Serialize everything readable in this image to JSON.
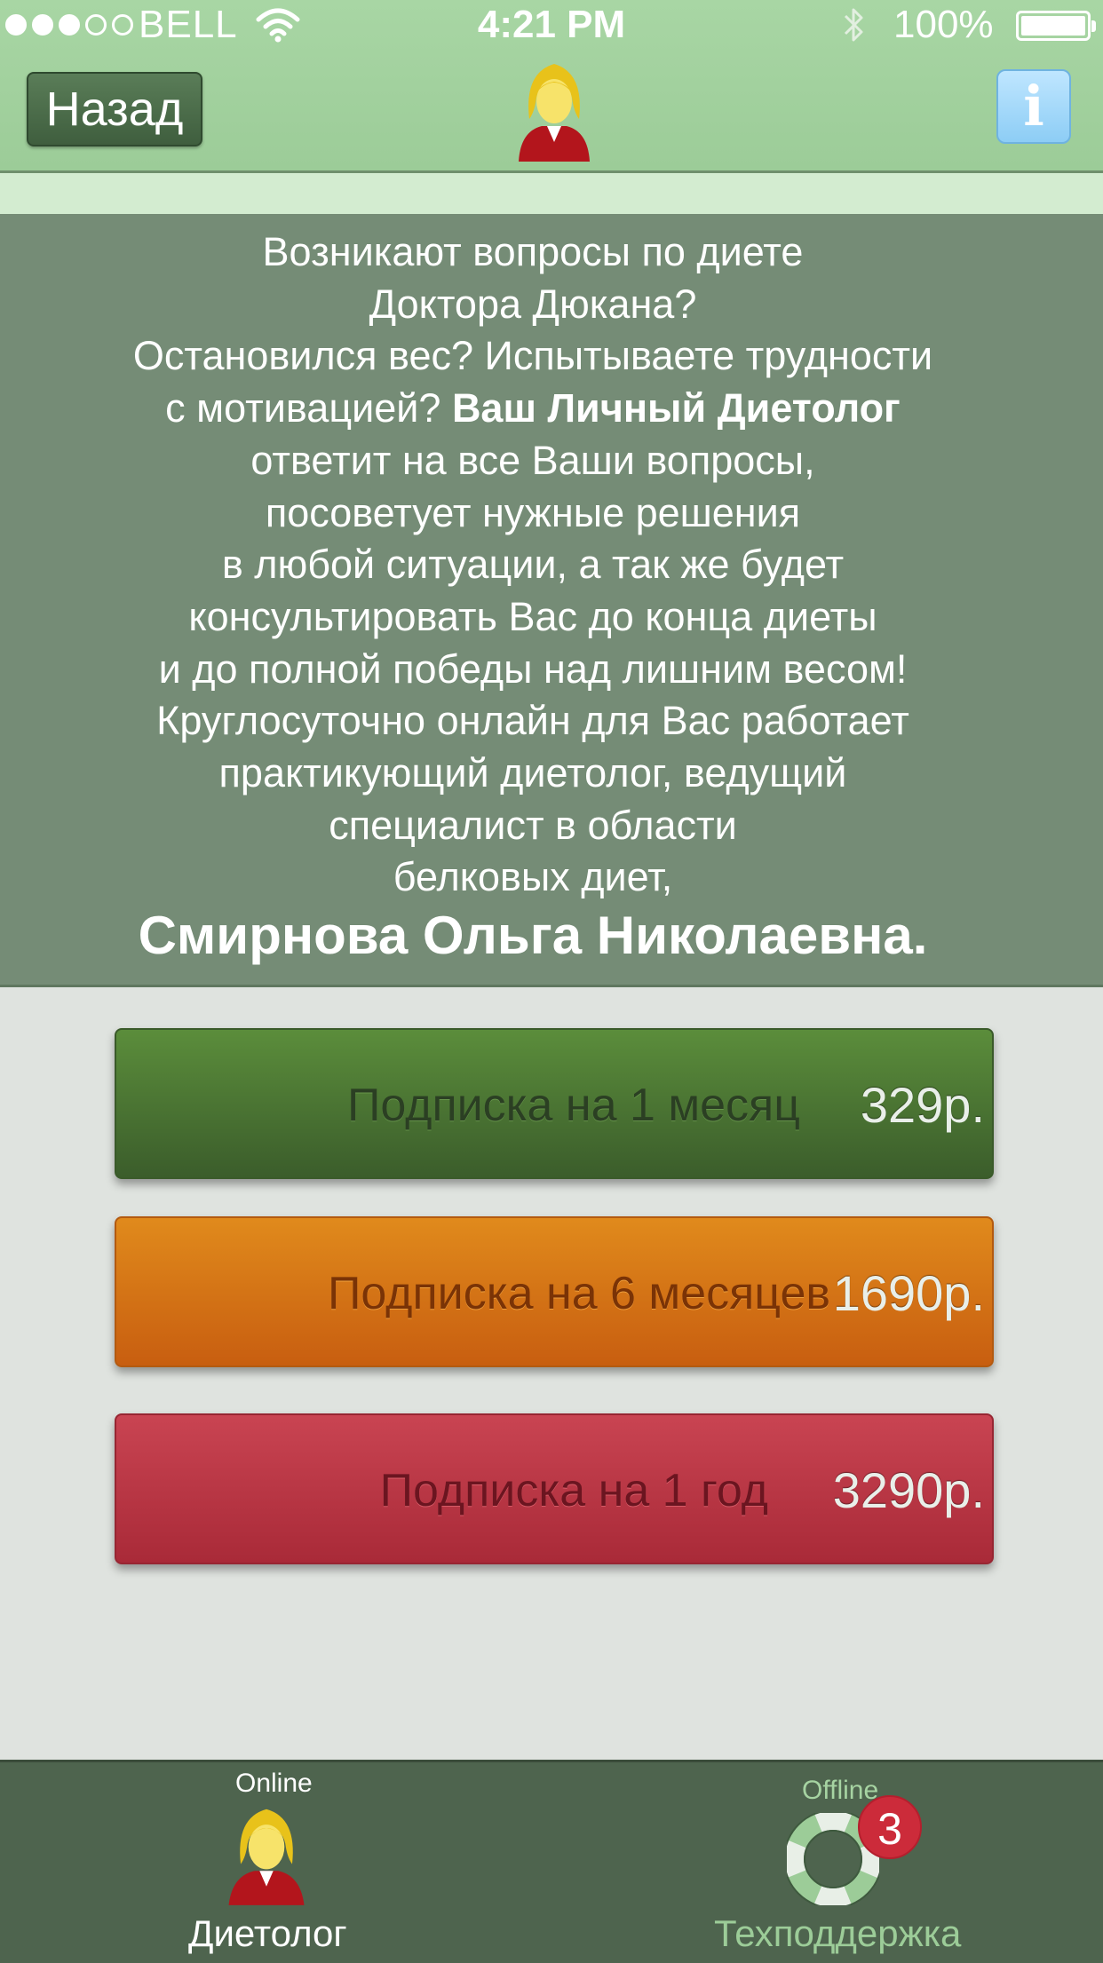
{
  "status_bar": {
    "carrier": "BELL",
    "time": "4:21 PM",
    "battery": "100%"
  },
  "nav": {
    "back_label": "Назад",
    "info_label": "i",
    "avatar_icon": "dietitian-avatar-icon"
  },
  "description": {
    "lines": [
      "Возникают вопросы по диете",
      "Доктора Дюкана?",
      "Остановился вес? Испытываете трудности",
      "с мотивацией? ",
      "Ваш Личный Диетолог",
      "ответит на все Ваши вопросы,",
      "посоветует нужные решения",
      "в любой ситуации, а так же будет",
      "консультировать Вас до конца диеты",
      "и до полной победы над лишним весом!",
      "Круглосуточно онлайн для Вас работает",
      "практикующий диетолог, ведущий",
      "специалист в области",
      "белковых диет,"
    ],
    "doctor_name": "Смирнова Ольга Николаевна."
  },
  "subscriptions": [
    {
      "label": "Подписка на 1 месяц",
      "price": "329р.",
      "color": "#4a7533"
    },
    {
      "label": "Подписка на 6 месяцев",
      "price": "1690р.",
      "color": "#d4761a"
    },
    {
      "label": "Подписка на 1 год",
      "price": "3290р.",
      "color": "#b93645"
    }
  ],
  "tabbar": {
    "tabs": [
      {
        "status": "Online",
        "label": "Диетолог",
        "icon": "dietitian-icon",
        "active": true
      },
      {
        "status": "Offline",
        "label": "Техподдержка",
        "icon": "lifebuoy-icon",
        "active": false,
        "badge": "3"
      }
    ]
  },
  "colors": {
    "nav_bg": "#9ccc98",
    "panel_bg": "#758c76",
    "tabbar_bg": "#4e644e",
    "badge": "#cc2b3a"
  }
}
